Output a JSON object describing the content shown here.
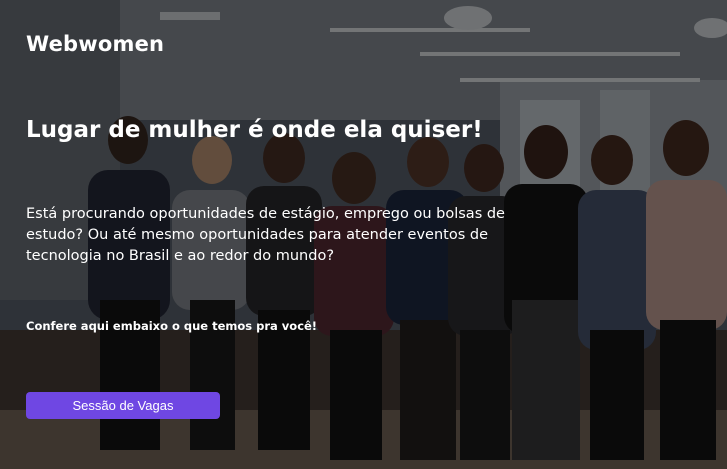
{
  "brand": {
    "name": "Webwomen"
  },
  "hero": {
    "headline": "Lugar de mulher é onde ela quiser!",
    "intro": "Está procurando oportunidades de estágio, emprego ou bolsas de estudo? Ou até mesmo oportunidades para atender eventos de tecnologia no Brasil e ao redor do mundo?",
    "callout": "Confere aqui embaixo o que temos pra você!",
    "cta_label": "Sessão de Vagas"
  },
  "colors": {
    "accent": "#6f47e3",
    "text": "#ffffff",
    "overlay": "rgba(0,0,0,0.50)"
  },
  "background": {
    "description_icon": "group-photo"
  }
}
